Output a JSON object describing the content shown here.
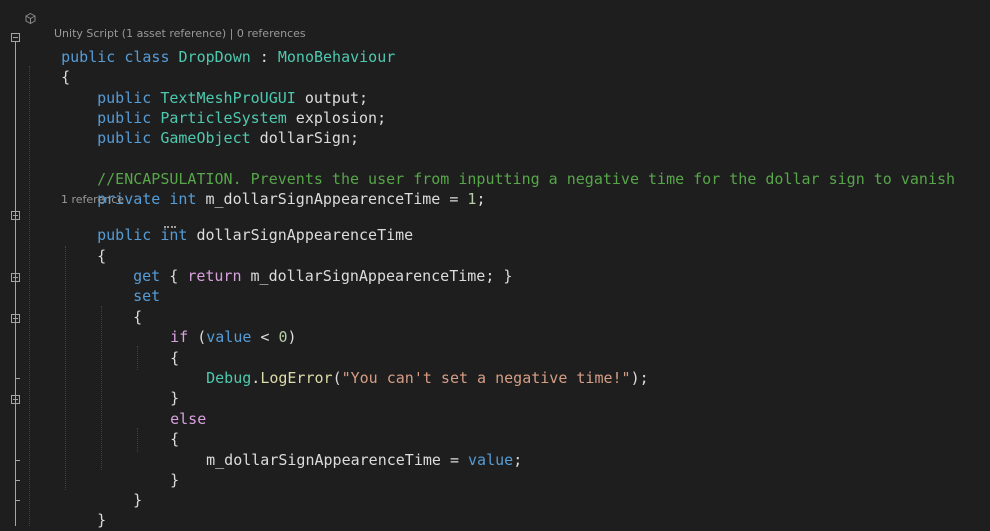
{
  "codelens": {
    "class_asset_ref": "Unity Script (1 asset reference)",
    "class_sep": " | ",
    "class_refs": "0 references",
    "property_refs": "1 reference"
  },
  "icons": {
    "codelens": "unity-icon",
    "fold": "collapse-minus-icon"
  },
  "colors": {
    "background": "#1e1e1e",
    "keyword": "#569cd6",
    "control": "#d8a0df",
    "type": "#4ec9b0",
    "method": "#dcdcaa",
    "string": "#d69d85",
    "number": "#b5cea8",
    "comment": "#57a64a",
    "text": "#dcdcdc"
  },
  "code": {
    "l1": {
      "kw1": "public",
      "kw2": "class",
      "name": "DropDown",
      "colon": " : ",
      "base": "MonoBehaviour"
    },
    "l2": {
      "brace": "{"
    },
    "l3": {
      "kw": "public",
      "type": "TextMeshProUGUI",
      "rest": " output;"
    },
    "l4": {
      "kw": "public",
      "type": "ParticleSystem",
      "rest": " explosion;"
    },
    "l5": {
      "kw": "public",
      "type": "GameObject",
      "rest": " dollarSign;"
    },
    "l6": {
      "comment": "//ENCAPSULATION. Prevents the user from inputting a negative time for the dollar sign to vanish"
    },
    "l7": {
      "kw1": "private",
      "kw2": "int",
      "rest": " m_dollarSignAppearenceTime = ",
      "num": "1",
      "end": ";"
    },
    "l8": {
      "kw1": "public",
      "kw2": "int",
      "name": "dollarSignAppearenceTime"
    },
    "l9": {
      "brace": "{"
    },
    "l10": {
      "get": "get",
      "open": " { ",
      "ret": "return",
      "rest": " m_dollarSignAppearenceTime; }"
    },
    "l11": {
      "set": "set"
    },
    "l12": {
      "brace": "{"
    },
    "l13": {
      "kw": "if",
      "open": " (",
      "value": "value",
      "rest": " < ",
      "num": "0",
      "close": ")"
    },
    "l14": {
      "brace": "{"
    },
    "l15": {
      "obj": "Debug",
      "dot": ".",
      "method": "LogError",
      "open": "(",
      "str": "\"You can't set a negative time!\"",
      "close": ");"
    },
    "l16": {
      "brace": "}"
    },
    "l17": {
      "kw": "else"
    },
    "l18": {
      "brace": "{"
    },
    "l19": {
      "rest": "m_dollarSignAppearenceTime = ",
      "value": "value",
      "end": ";"
    },
    "l20": {
      "brace": "}"
    },
    "l21": {
      "brace": "}"
    },
    "l22": {
      "brace": "}"
    }
  }
}
